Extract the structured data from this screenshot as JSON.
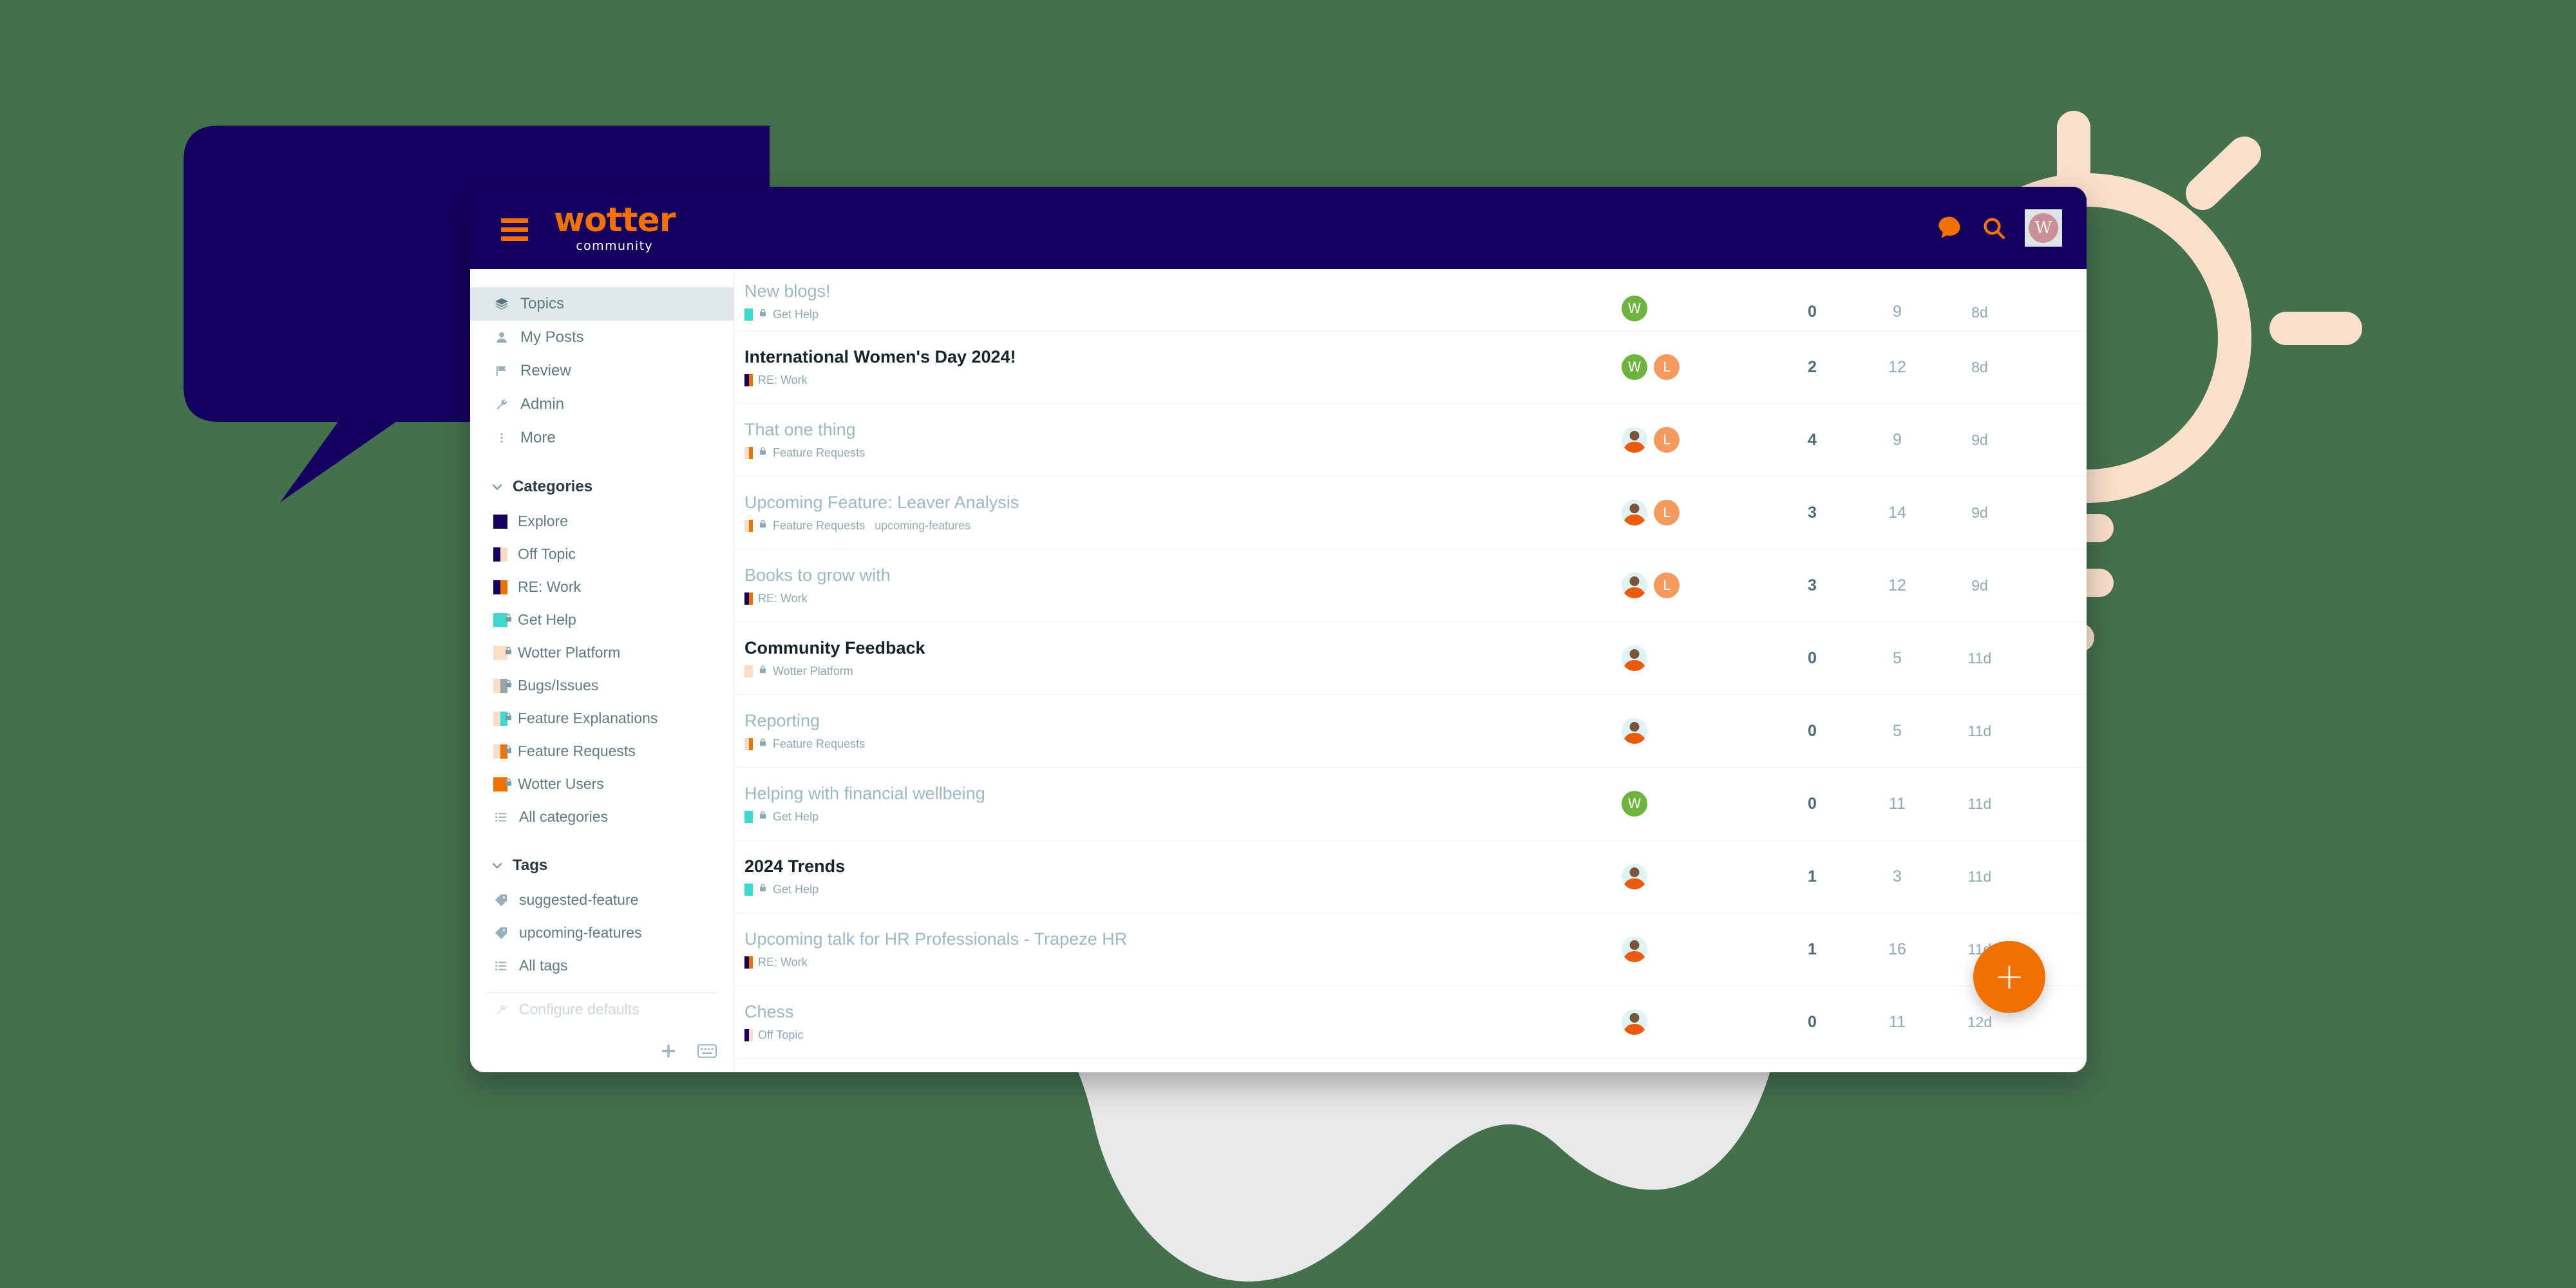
{
  "decor": {
    "page_background": "#44704D",
    "speech_bubble_color": "#150060",
    "lightbulb_color": "#FBE0CC",
    "blob_color": "#E8E9EB"
  },
  "window": {
    "topbar": {
      "menu_icon": "hamburger-icon",
      "brand_name": "wotter",
      "brand_tagline": "community",
      "brand_color": "#F07000",
      "chat_icon": "chat-bubble-icon",
      "search_icon": "search-icon",
      "avatar_initial": "W"
    }
  },
  "sidebar": {
    "nav": [
      {
        "label": "Topics",
        "icon": "layers-icon",
        "active": true
      },
      {
        "label": "My Posts",
        "icon": "user-icon",
        "active": false
      },
      {
        "label": "Review",
        "icon": "flag-icon",
        "active": false
      },
      {
        "label": "Admin",
        "icon": "wrench-icon",
        "active": false
      },
      {
        "label": "More",
        "icon": "dots-vertical-icon",
        "active": false
      }
    ],
    "categories_heading": "Categories",
    "categories": [
      {
        "label": "Explore",
        "colors": [
          "#150060"
        ],
        "locked": false
      },
      {
        "label": "Off Topic",
        "colors": [
          "#150060",
          "#FBDCC6"
        ],
        "locked": false
      },
      {
        "label": "RE: Work",
        "colors": [
          "#150060",
          "#F07000"
        ],
        "locked": false
      },
      {
        "label": "Get Help",
        "colors": [
          "#3FD9D0"
        ],
        "locked": true
      },
      {
        "label": "Wotter Platform",
        "colors": [
          "#FBDCC6"
        ],
        "locked": true
      },
      {
        "label": "Bugs/Issues",
        "colors": [
          "#FBDCC6",
          "#9AA3A8"
        ],
        "locked": true
      },
      {
        "label": "Feature Explanations",
        "colors": [
          "#FBDCC6",
          "#3FD9D0"
        ],
        "locked": true
      },
      {
        "label": "Feature Requests",
        "colors": [
          "#FBDCC6",
          "#F07000"
        ],
        "locked": true
      },
      {
        "label": "Wotter Users",
        "colors": [
          "#F07000"
        ],
        "locked": true
      }
    ],
    "all_categories_label": "All categories",
    "tags_heading": "Tags",
    "tags": [
      {
        "label": "suggested-feature"
      },
      {
        "label": "upcoming-features"
      }
    ],
    "all_tags_label": "All tags",
    "configure_defaults_label": "Configure defaults",
    "footer": {
      "add_icon": "plus-icon",
      "keyboard_icon": "keyboard-icon"
    }
  },
  "topics": [
    {
      "title": "New blogs!",
      "read": true,
      "category": "Get Help",
      "category_colors": [
        "#3FD9D0"
      ],
      "locked": true,
      "tag": "",
      "posters": [
        {
          "type": "initial",
          "letter": "W",
          "color": "green"
        }
      ],
      "replies": "0",
      "views": "9",
      "activity": "8d"
    },
    {
      "title": "International Women's Day 2024!",
      "read": false,
      "category": "RE: Work",
      "category_colors": [
        "#150060",
        "#F07000"
      ],
      "locked": false,
      "tag": "",
      "posters": [
        {
          "type": "initial",
          "letter": "W",
          "color": "green"
        },
        {
          "type": "initial",
          "letter": "L",
          "color": "orange"
        }
      ],
      "replies": "2",
      "views": "12",
      "activity": "8d"
    },
    {
      "title": "That one thing",
      "read": true,
      "category": "Feature Requests",
      "category_colors": [
        "#FBDCC6",
        "#F07000"
      ],
      "locked": true,
      "tag": "",
      "posters": [
        {
          "type": "photo"
        },
        {
          "type": "initial",
          "letter": "L",
          "color": "orange"
        }
      ],
      "replies": "4",
      "views": "9",
      "activity": "9d"
    },
    {
      "title": "Upcoming Feature: Leaver Analysis",
      "read": true,
      "category": "Feature Requests",
      "category_colors": [
        "#FBDCC6",
        "#F07000"
      ],
      "locked": true,
      "tag": "upcoming-features",
      "posters": [
        {
          "type": "photo"
        },
        {
          "type": "initial",
          "letter": "L",
          "color": "orange"
        }
      ],
      "replies": "3",
      "views": "14",
      "activity": "9d"
    },
    {
      "title": "Books to grow with",
      "read": true,
      "category": "RE: Work",
      "category_colors": [
        "#150060",
        "#F07000"
      ],
      "locked": false,
      "tag": "",
      "posters": [
        {
          "type": "photo"
        },
        {
          "type": "initial",
          "letter": "L",
          "color": "orange"
        }
      ],
      "replies": "3",
      "views": "12",
      "activity": "9d"
    },
    {
      "title": "Community Feedback",
      "read": false,
      "category": "Wotter Platform",
      "category_colors": [
        "#FBDCC6"
      ],
      "locked": true,
      "tag": "",
      "posters": [
        {
          "type": "photo"
        }
      ],
      "replies": "0",
      "views": "5",
      "activity": "11d"
    },
    {
      "title": "Reporting",
      "read": true,
      "category": "Feature Requests",
      "category_colors": [
        "#FBDCC6",
        "#F07000"
      ],
      "locked": true,
      "tag": "",
      "posters": [
        {
          "type": "photo"
        }
      ],
      "replies": "0",
      "views": "5",
      "activity": "11d"
    },
    {
      "title": "Helping with financial wellbeing",
      "read": true,
      "category": "Get Help",
      "category_colors": [
        "#3FD9D0"
      ],
      "locked": true,
      "tag": "",
      "posters": [
        {
          "type": "initial",
          "letter": "W",
          "color": "green"
        }
      ],
      "replies": "0",
      "views": "11",
      "activity": "11d"
    },
    {
      "title": "2024 Trends",
      "read": false,
      "category": "Get Help",
      "category_colors": [
        "#3FD9D0"
      ],
      "locked": true,
      "tag": "",
      "posters": [
        {
          "type": "photo"
        }
      ],
      "replies": "1",
      "views": "3",
      "activity": "11d"
    },
    {
      "title": "Upcoming talk for HR Professionals - Trapeze HR",
      "read": true,
      "category": "RE: Work",
      "category_colors": [
        "#150060",
        "#F07000"
      ],
      "locked": false,
      "tag": "",
      "posters": [
        {
          "type": "photo"
        }
      ],
      "replies": "1",
      "views": "16",
      "activity": "11d"
    },
    {
      "title": "Chess",
      "read": true,
      "category": "Off Topic",
      "category_colors": [
        "#150060",
        "#FBDCC6"
      ],
      "locked": false,
      "tag": "",
      "posters": [
        {
          "type": "photo"
        }
      ],
      "replies": "0",
      "views": "11",
      "activity": "12d"
    }
  ],
  "fab": {
    "label": "+"
  }
}
